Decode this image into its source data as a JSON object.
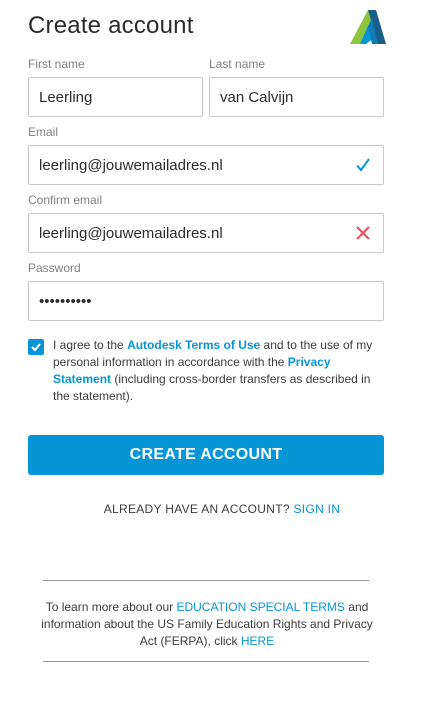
{
  "header": {
    "title": "Create account",
    "logo_icon": "autodesk-logo-icon"
  },
  "form": {
    "first_name": {
      "label": "First name",
      "value": "Leerling"
    },
    "last_name": {
      "label": "Last name",
      "value": "van Calvijn"
    },
    "email": {
      "label": "Email",
      "value": "leerling@jouwemailadres.nl",
      "status_icon": "check-icon"
    },
    "confirm_email": {
      "label": "Confirm email",
      "value": "leerling@jouwemailadres.nl",
      "status_icon": "error-x-icon"
    },
    "password": {
      "label": "Password",
      "value": "••••••••••"
    }
  },
  "agreement": {
    "checked": true,
    "text_1": "I agree to the ",
    "link_terms": "Autodesk Terms of Use",
    "text_2": " and to the use of my personal information in accordance with the ",
    "link_privacy": "Privacy Statement",
    "text_3": " (including cross-border transfers as described in the statement)."
  },
  "cta": {
    "label": "CREATE ACCOUNT"
  },
  "signin": {
    "prompt": "ALREADY HAVE AN ACCOUNT?",
    "link": "SIGN IN"
  },
  "education": {
    "text_1": "To learn more about our ",
    "link_terms": "EDUCATION SPECIAL TERMS",
    "text_2": " and information about the US Family Education Rights and Privacy Act (FERPA), click ",
    "link_here": "HERE"
  },
  "colors": {
    "accent": "#0696d7",
    "check": "#0696d7",
    "error": "#e8505b"
  }
}
